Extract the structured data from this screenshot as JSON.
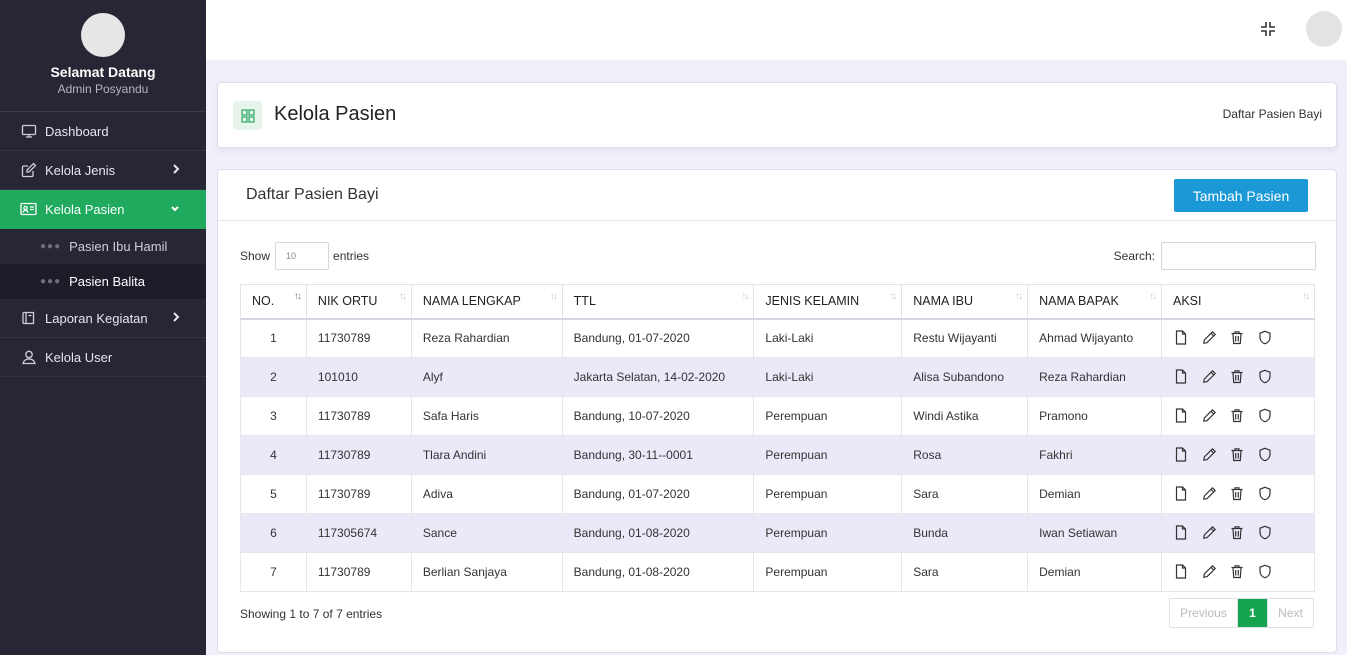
{
  "sidebar": {
    "welcome": "Selamat Datang",
    "role": "Admin Posyandu",
    "items": [
      {
        "label": "Dashboard",
        "icon": "monitor-icon"
      },
      {
        "label": "Kelola Jenis",
        "icon": "edit-icon"
      },
      {
        "label": "Kelola Pasien",
        "icon": "id-card-icon"
      },
      {
        "label": "Laporan Kegiatan",
        "icon": "book-icon"
      },
      {
        "label": "Kelola User",
        "icon": "user-icon"
      }
    ],
    "subitems": [
      {
        "label": "Pasien Ibu Hamil"
      },
      {
        "label": "Pasien Balita"
      }
    ]
  },
  "page": {
    "title": "Kelola Pasien",
    "breadcrumb": "Daftar Pasien Bayi"
  },
  "card": {
    "title": "Daftar Pasien Bayi",
    "add_button": "Tambah Pasien"
  },
  "controls": {
    "show_label": "Show",
    "entries_value": "10",
    "entries_label": "entries",
    "search_label": "Search:"
  },
  "table": {
    "headers": [
      "NO.",
      "NIK ORTU",
      "NAMA LENGKAP",
      "TTL",
      "JENIS KELAMIN",
      "NAMA IBU",
      "NAMA BAPAK",
      "AKSI"
    ],
    "rows": [
      [
        "1",
        "11730789",
        "Reza Rahardian",
        "Bandung, 01-07-2020",
        "Laki-Laki",
        "Restu Wijayanti",
        "Ahmad Wijayanto"
      ],
      [
        "2",
        "101010",
        "Alyf",
        "Jakarta Selatan, 14-02-2020",
        "Laki-Laki",
        "Alisa Subandono",
        "Reza Rahardian"
      ],
      [
        "3",
        "11730789",
        "Safa Haris",
        "Bandung, 10-07-2020",
        "Perempuan",
        "Windi Astika",
        "Pramono"
      ],
      [
        "4",
        "11730789",
        "Tlara Andini",
        "Bandung, 30-11--0001",
        "Perempuan",
        "Rosa",
        "Fakhri"
      ],
      [
        "5",
        "11730789",
        "Adiva",
        "Bandung, 01-07-2020",
        "Perempuan",
        "Sara",
        "Demian"
      ],
      [
        "6",
        "117305674",
        "Sance",
        "Bandung, 01-08-2020",
        "Perempuan",
        "Bunda",
        "Iwan Setiawan"
      ],
      [
        "7",
        "11730789",
        "Berlian Sanjaya",
        "Bandung, 01-08-2020",
        "Perempuan",
        "Sara",
        "Demian"
      ]
    ],
    "actions": [
      "file-icon",
      "pencil-icon",
      "trash-icon",
      "shield-icon"
    ]
  },
  "footer": {
    "info": "Showing 1 to 7 of 7 entries",
    "prev": "Previous",
    "current_page": "1",
    "next": "Next"
  },
  "colors": {
    "sidebar_bg": "#272635",
    "active_green": "#1faa5e",
    "button_blue": "#1b98d6",
    "stripe": "#e9e9f8"
  }
}
